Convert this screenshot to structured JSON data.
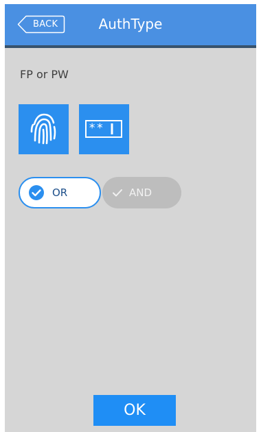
{
  "header": {
    "back_label": "BACK",
    "title": "AuthType"
  },
  "main": {
    "subtitle": "FP or PW",
    "methods": [
      {
        "icon": "fingerprint-icon"
      },
      {
        "icon": "password-icon",
        "text": "**"
      }
    ],
    "logic_options": [
      {
        "label": "OR",
        "selected": true
      },
      {
        "label": "AND",
        "selected": false
      }
    ]
  },
  "footer": {
    "ok_label": "OK"
  },
  "colors": {
    "header": "#4a90e2",
    "accent": "#2b8fef",
    "background": "#d6d6d6"
  }
}
